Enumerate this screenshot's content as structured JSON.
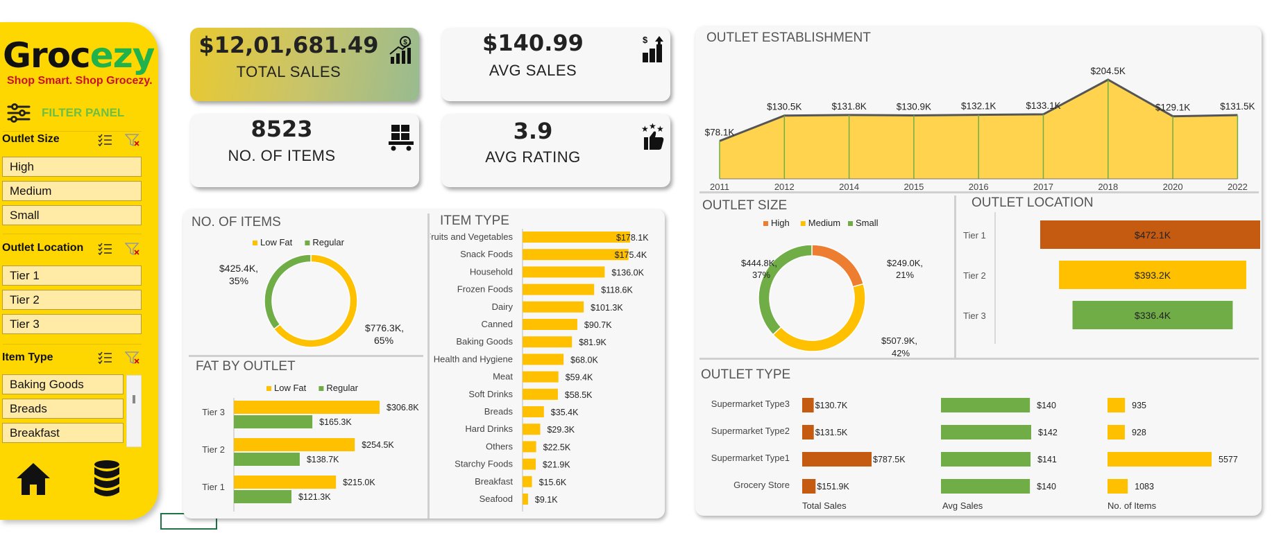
{
  "sidebar": {
    "logo_part1": "Groc",
    "logo_part2": "ezy",
    "tagline": "Shop Smart. Shop Grocezy.",
    "filter_panel_label": "FILTER PANEL",
    "slicers": [
      {
        "title": "Outlet Size",
        "items": [
          "High",
          "Medium",
          "Small"
        ]
      },
      {
        "title": "Outlet Location",
        "items": [
          "Tier 1",
          "Tier 2",
          "Tier 3"
        ]
      },
      {
        "title": "Item Type",
        "items": [
          "Baking Goods",
          "Breads",
          "Breakfast"
        ]
      }
    ],
    "nav": [
      "home-icon",
      "database-icon"
    ]
  },
  "kpis": {
    "total_sales": {
      "value": "$12,01,681.49",
      "label": "TOTAL SALES"
    },
    "avg_sales": {
      "value": "$140.99",
      "label": "AVG SALES"
    },
    "items": {
      "value": "8523",
      "label": "NO. OF ITEMS"
    },
    "avg_rating": {
      "value": "3.9",
      "label": "AVG RATING"
    }
  },
  "colors": {
    "yellow": "#FFC000",
    "green": "#70AD47",
    "orange": "#C55A11",
    "accent_green": "#22B24C",
    "brand_red": "#C8102E",
    "panel_bg": "#F7F7F7"
  },
  "chart_data": [
    {
      "id": "no_of_items",
      "type": "pie",
      "title": "NO. OF ITEMS",
      "legend": [
        "Low Fat",
        "Regular"
      ],
      "slices": [
        {
          "name": "Low Fat",
          "value": 776.3,
          "label": "$776.3K,",
          "pct": "65%",
          "color": "#FFC000"
        },
        {
          "name": "Regular",
          "value": 425.4,
          "label": "$425.4K,",
          "pct": "35%",
          "color": "#70AD47"
        }
      ]
    },
    {
      "id": "fat_by_outlet",
      "type": "bar",
      "title": "FAT BY OUTLET",
      "legend": [
        "Low Fat",
        "Regular"
      ],
      "categories": [
        "Tier 3",
        "Tier 2",
        "Tier 1"
      ],
      "series": [
        {
          "name": "Low Fat",
          "values": [
            306.8,
            254.5,
            215.0
          ],
          "labels": [
            "$306.8K",
            "$254.5K",
            "$215.0K"
          ],
          "color": "#FFC000"
        },
        {
          "name": "Regular",
          "values": [
            165.3,
            138.7,
            121.3
          ],
          "labels": [
            "$165.3K",
            "$138.7K",
            "$121.3K"
          ],
          "color": "#70AD47"
        }
      ]
    },
    {
      "id": "item_type",
      "type": "bar",
      "title": "ITEM TYPE",
      "categories": [
        "Fruits and Vegetables",
        "Snack Foods",
        "Household",
        "Frozen Foods",
        "Dairy",
        "Canned",
        "Baking Goods",
        "Health and Hygiene",
        "Meat",
        "Soft Drinks",
        "Breads",
        "Hard Drinks",
        "Others",
        "Starchy Foods",
        "Breakfast",
        "Seafood"
      ],
      "values": [
        178.1,
        175.4,
        136.0,
        118.6,
        101.3,
        90.7,
        81.9,
        68.0,
        59.4,
        58.5,
        35.4,
        29.3,
        22.5,
        21.9,
        15.6,
        9.1
      ],
      "labels": [
        "$178.1K",
        "$175.4K",
        "$136.0K",
        "$118.6K",
        "$101.3K",
        "$90.7K",
        "$81.9K",
        "$68.0K",
        "$59.4K",
        "$58.5K",
        "$35.4K",
        "$29.3K",
        "$22.5K",
        "$21.9K",
        "$15.6K",
        "$9.1K"
      ],
      "color": "#FFC000"
    },
    {
      "id": "outlet_establishment",
      "type": "area",
      "title": "OUTLET ESTABLISHMENT",
      "categories": [
        "2011",
        "2012",
        "2014",
        "2015",
        "2016",
        "2017",
        "2018",
        "2020",
        "2022"
      ],
      "values": [
        78.1,
        130.5,
        131.8,
        130.9,
        132.1,
        133.1,
        204.5,
        129.1,
        131.5
      ],
      "labels": [
        "$78.1K",
        "$130.5K",
        "$131.8K",
        "$130.9K",
        "$132.1K",
        "$133.1K",
        "$204.5K",
        "$129.1K",
        "$131.5K"
      ],
      "color": "#FFD34D"
    },
    {
      "id": "outlet_size",
      "type": "pie",
      "title": "OUTLET SIZE",
      "legend": [
        "High",
        "Medium",
        "Small"
      ],
      "slices": [
        {
          "name": "High",
          "value": 249.0,
          "label": "$249.0K,",
          "pct": "21%",
          "color": "#ED7D31"
        },
        {
          "name": "Medium",
          "value": 507.9,
          "label": "$507.9K,",
          "pct": "42%",
          "color": "#FFC000"
        },
        {
          "name": "Small",
          "value": 444.8,
          "label": "$444.8K,",
          "pct": "37%",
          "color": "#70AD47"
        }
      ]
    },
    {
      "id": "outlet_location",
      "type": "bar",
      "title": "OUTLET LOCATION",
      "categories": [
        "Tier 1",
        "Tier 2",
        "Tier 3"
      ],
      "values": [
        472.1,
        393.2,
        336.4
      ],
      "labels": [
        "$472.1K",
        "$393.2K",
        "$336.4K"
      ],
      "colors": [
        "#C55A11",
        "#FFC000",
        "#70AD47"
      ]
    },
    {
      "id": "outlet_type",
      "type": "bar",
      "title": "OUTLET TYPE",
      "categories": [
        "Supermarket Type3",
        "Supermarket Type2",
        "Supermarket Type1",
        "Grocery Store"
      ],
      "series": [
        {
          "name": "Total Sales",
          "values": [
            130.7,
            131.5,
            787.5,
            151.9
          ],
          "labels": [
            "$130.7K",
            "$131.5K",
            "$787.5K",
            "$151.9K"
          ],
          "color": "#C55A11"
        },
        {
          "name": "Avg Sales",
          "values": [
            140,
            142,
            141,
            140
          ],
          "labels": [
            "$140",
            "$142",
            "$141",
            "$140"
          ],
          "color": "#70AD47"
        },
        {
          "name": "No. of Items",
          "values": [
            935,
            928,
            5577,
            1083
          ],
          "labels": [
            "935",
            "928",
            "5577",
            "1083"
          ],
          "color": "#FFC000"
        }
      ]
    }
  ]
}
